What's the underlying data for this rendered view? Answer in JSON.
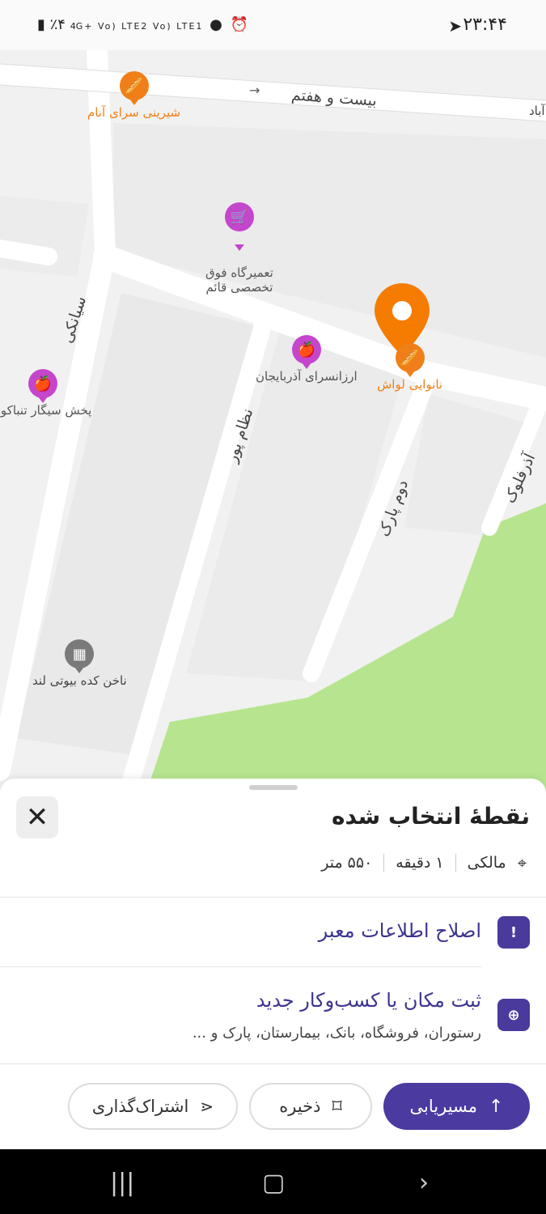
{
  "status_bar": {
    "time": "۲۳:۴۴",
    "battery": "٪۴",
    "signals": "4G+ Vo) LTE2 Vo) LTE1"
  },
  "map": {
    "streets": {
      "bist_o_haftom": "بیست و هفتم",
      "abad": "آباد",
      "sianaki": "سیانکی",
      "nezampour": "نظام پور",
      "dovom_park": "دوم پارک",
      "azarfalak": "آذرفلوک"
    },
    "pois": [
      {
        "label": "شیرینی سرای آنام",
        "icon": "bakery-icon",
        "color": "#f07f19"
      },
      {
        "label": "تعمیرگاه فوق\nتخصصی قائم",
        "icon": "shopping-basket-icon",
        "color": "#c446cc"
      },
      {
        "label": "ارزانسرای آذربایجان",
        "icon": "grocery-icon",
        "color": "#c446cc"
      },
      {
        "label": "نانوایی لواش",
        "icon": "bakery-icon",
        "color": "#f07f19"
      },
      {
        "label": "پخش سیگار تنباکو ا",
        "icon": "grocery-icon",
        "color": "#c446cc"
      },
      {
        "label": "ناخن کده بیوتی لند",
        "icon": "building-icon",
        "color": "#7a7a7a"
      }
    ],
    "selected_marker_color": "#f57c00",
    "park_color": "#b7e58f"
  },
  "sheet": {
    "title": "نقطهٔ انتخاب شده",
    "location": "مالکی",
    "duration": "۱ دقیقه",
    "distance": "۵۵۰ متر",
    "fix_info": "اصلاح اطلاعات معبر",
    "add_place": "ثبت مکان یا کسب‌وکار جدید",
    "add_place_sub": "رستوران، فروشگاه، بانک، بیمارستان، پارک و ...",
    "route_label": "مسیریابی",
    "save_label": "ذخیره",
    "share_label": "اشتراک‌گذاری"
  },
  "colors": {
    "accent": "#4b3aa0"
  }
}
